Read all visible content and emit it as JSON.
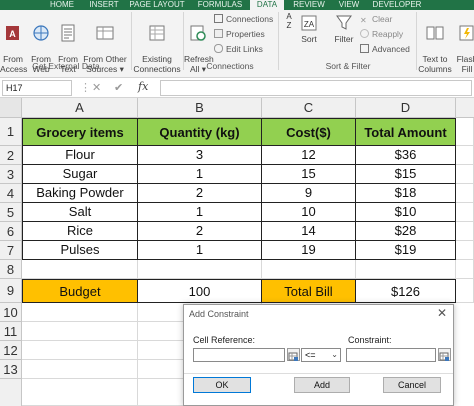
{
  "ribbon": {
    "tabs": [
      "HOME",
      "INSERT",
      "PAGE LAYOUT",
      "FORMULAS",
      "DATA",
      "REVIEW",
      "VIEW",
      "DEVELOPER"
    ],
    "buttons": {
      "from_access": "From\nAccess",
      "from_web": "From\nWeb",
      "from_text": "From\nText",
      "from_other": "From Other\nSources ▾",
      "existing": "Existing\nConnections",
      "refresh": "Refresh\nAll ▾",
      "sort": "Sort",
      "filter": "Filter",
      "text_to_columns": "Text to\nColumns",
      "flash_fill": "Flash\nFill"
    },
    "small": {
      "connections": "Connections",
      "properties": "Properties",
      "edit_links": "Edit Links",
      "clear": "Clear",
      "reapply": "Reapply",
      "advanced": "Advanced"
    },
    "groups": {
      "get_external": "Get External Data",
      "connections": "Connections",
      "sort_filter": "Sort & Filter"
    }
  },
  "formula_bar": {
    "name_box": "H17",
    "fx": "fx",
    "cancel": "✕",
    "enter": "✔",
    "value": ""
  },
  "columns": [
    "A",
    "B",
    "C",
    "D"
  ],
  "rows": [
    "1",
    "2",
    "3",
    "4",
    "5",
    "6",
    "7",
    "8",
    "9",
    "10",
    "11",
    "12",
    "13"
  ],
  "table": {
    "headers": [
      "Grocery items",
      "Quantity (kg)",
      "Cost($)",
      "Total Amount"
    ],
    "items": [
      [
        "Flour",
        "3",
        "12",
        "$36"
      ],
      [
        "Sugar",
        "1",
        "15",
        "$15"
      ],
      [
        "Baking Powder",
        "2",
        "9",
        "$18"
      ],
      [
        "Salt",
        "1",
        "10",
        "$10"
      ],
      [
        "Rice",
        "2",
        "14",
        "$28"
      ],
      [
        "Pulses",
        "1",
        "19",
        "$19"
      ]
    ],
    "budget_label": "Budget",
    "budget_value": "100",
    "bill_label": "Total Bill",
    "bill_value": "$126"
  },
  "dialog": {
    "title": "Add Constraint",
    "close": "✕",
    "cell_reference_label": "Cell Reference:",
    "constraint_label": "Constraint:",
    "operator": "<=",
    "ok": "OK",
    "add": "Add",
    "cancel": "Cancel",
    "cell_reference_value": "",
    "constraint_value": ""
  },
  "colors": {
    "ribbon_green": "#217346",
    "header_fill": "#92d050",
    "budget_fill": "#ffc000"
  }
}
